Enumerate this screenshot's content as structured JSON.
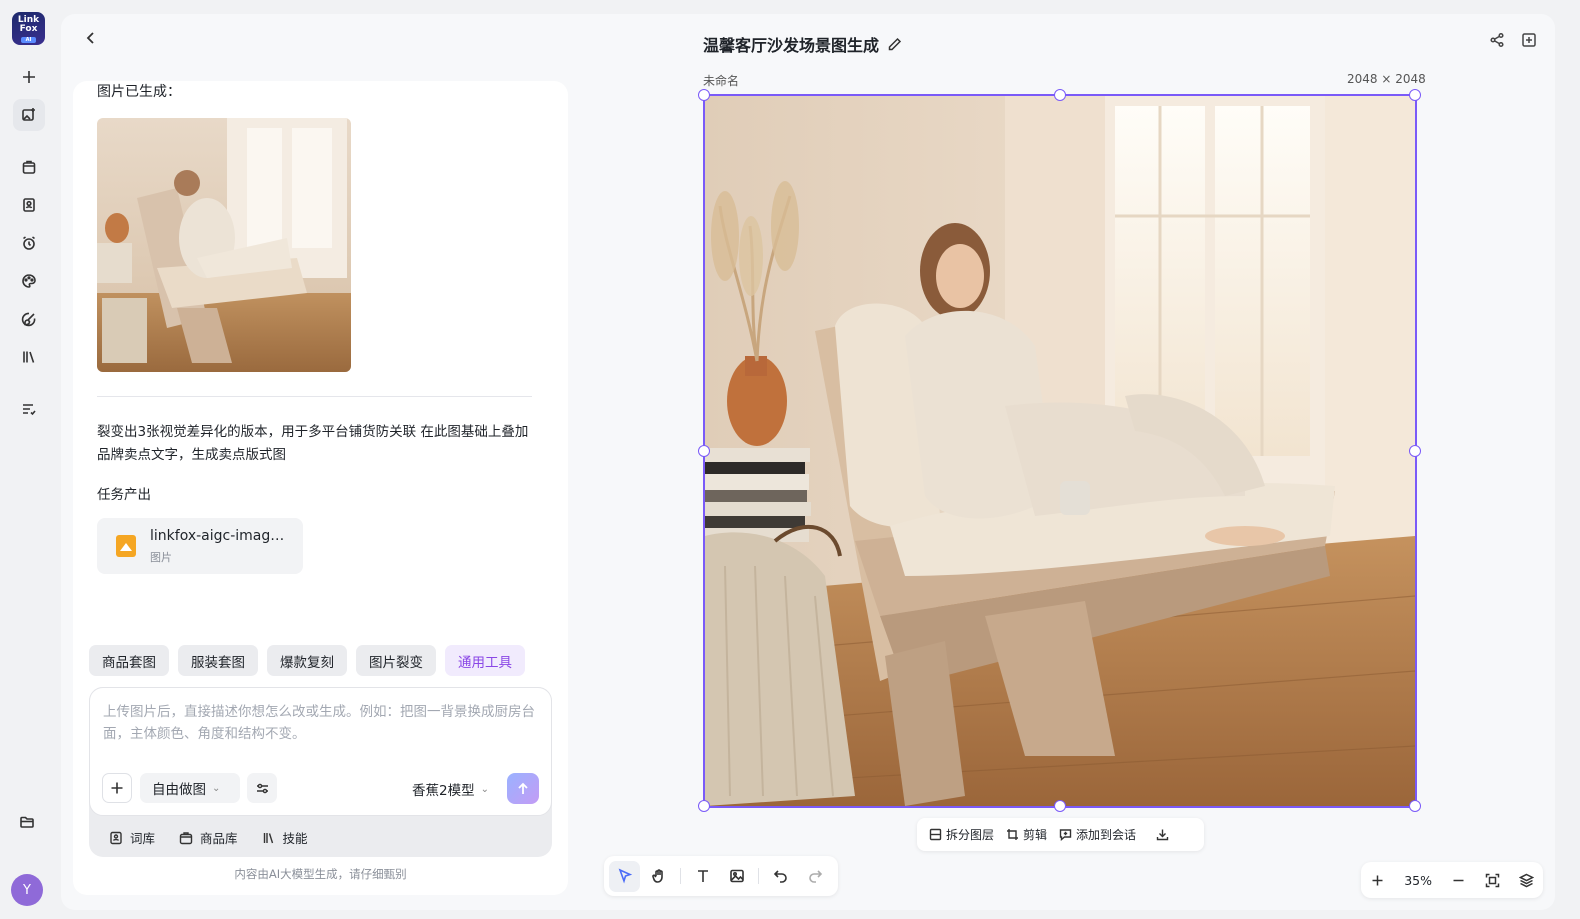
{
  "app": {
    "logo_lines": [
      "Link",
      "Fox"
    ],
    "logo_badge": "AI",
    "avatar_initial": "Y"
  },
  "rail": {
    "items": [
      {
        "icon": "plus-icon",
        "active": false
      },
      {
        "icon": "image-edit-icon",
        "active": true
      },
      {
        "icon": "shopping-bag-icon",
        "active": false
      },
      {
        "icon": "document-person-icon",
        "active": false
      },
      {
        "icon": "alarm-clock-icon",
        "active": false
      },
      {
        "icon": "palette-icon",
        "active": false
      },
      {
        "icon": "brush-icon",
        "active": false
      },
      {
        "icon": "library-icon",
        "active": false
      },
      {
        "icon": "checklist-icon",
        "active": false
      }
    ]
  },
  "header": {
    "title": "温馨客厅沙发场景图生成"
  },
  "chat": {
    "generated_label": "图片已生成：",
    "prompt": "裂变出3张视觉差异化的版本，用于多平台铺货防关联 在此图基础上叠加品牌卖点文字，生成卖点版式图",
    "task_output_label": "任务产出",
    "file": {
      "name": "linkfox-aigc-image-pseudo-bifurcate.png",
      "type": "图片"
    },
    "chips": [
      {
        "label": "商品套图",
        "accent": false
      },
      {
        "label": "服装套图",
        "accent": false
      },
      {
        "label": "爆款复刻",
        "accent": false
      },
      {
        "label": "图片裂变",
        "accent": false
      },
      {
        "label": "通用工具",
        "accent": true
      }
    ],
    "composer": {
      "placeholder": "上传图片后，直接描述你想怎么改或生成。例如：把图一背景换成厨房台面，主体颜色、角度和结构不变。",
      "mode": "自由做图",
      "model": "香蕉2模型"
    },
    "tools": [
      {
        "label": "词库",
        "icon": "book-person-icon"
      },
      {
        "label": "商品库",
        "icon": "shopping-bag-icon"
      },
      {
        "label": "技能",
        "icon": "library-icon"
      }
    ],
    "disclaimer": "内容由AI大模型生成，请仔细甄别"
  },
  "canvas": {
    "frame_name": "未命名",
    "frame_size": "2048 × 2048",
    "float_actions": [
      {
        "label": "拆分图层",
        "icon": "layers-split-icon"
      },
      {
        "label": "剪辑",
        "icon": "crop-icon"
      },
      {
        "label": "添加到会话",
        "icon": "chat-add-icon"
      }
    ],
    "zoom": "35%"
  },
  "colors": {
    "accent": "#7a5af8",
    "chip_accent_bg": "#f1ebfd",
    "chip_accent_text": "#8a47e6",
    "file_icon": "#f5a623"
  }
}
